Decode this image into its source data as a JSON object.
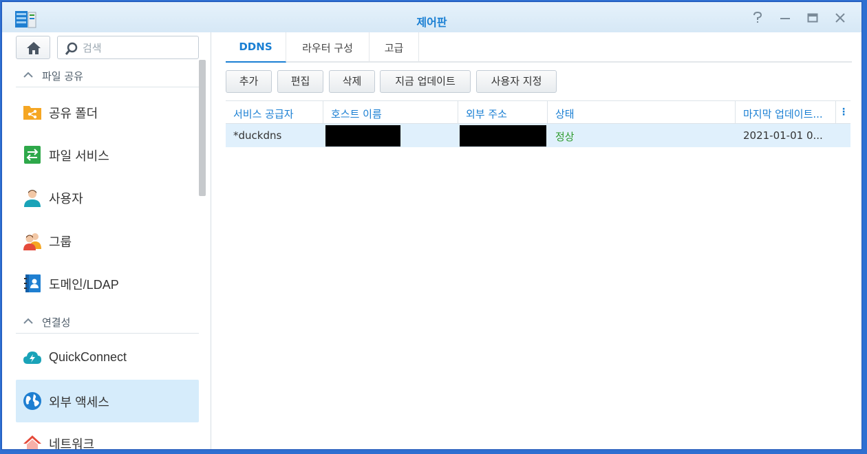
{
  "window": {
    "title": "제어판"
  },
  "sidebar": {
    "search_placeholder": "검색",
    "groups": [
      {
        "label": "파일 공유"
      },
      {
        "label": "연결성"
      }
    ],
    "items": [
      {
        "label": "공유 폴더",
        "icon": "shared-folder-icon"
      },
      {
        "label": "파일 서비스",
        "icon": "file-services-icon"
      },
      {
        "label": "사용자",
        "icon": "user-icon"
      },
      {
        "label": "그룹",
        "icon": "group-icon"
      },
      {
        "label": "도메인/LDAP",
        "icon": "domain-ldap-icon"
      },
      {
        "label": "QuickConnect",
        "icon": "quickconnect-icon"
      },
      {
        "label": "외부 액세스",
        "icon": "external-access-icon",
        "active": true
      },
      {
        "label": "네트워크",
        "icon": "network-icon"
      }
    ]
  },
  "tabs": [
    {
      "label": "DDNS",
      "active": true
    },
    {
      "label": "라우터 구성"
    },
    {
      "label": "고급"
    }
  ],
  "toolbar": {
    "add": "추가",
    "edit": "편집",
    "delete": "삭제",
    "update_now": "지금 업데이트",
    "customize": "사용자 지정"
  },
  "table": {
    "columns": [
      "서비스 공급자",
      "호스트 이름",
      "외부 주소",
      "상태",
      "마지막 업데이트..."
    ],
    "rows": [
      {
        "provider": "*duckdns",
        "hostname": "",
        "external_address": "",
        "status": "정상",
        "last_update": "2021-01-01 0..."
      }
    ]
  },
  "colors": {
    "accent": "#1a7fd3",
    "status_ok": "#2e9b2e",
    "selected_row": "#e0f0fc",
    "active_nav": "#d6ecfb"
  }
}
